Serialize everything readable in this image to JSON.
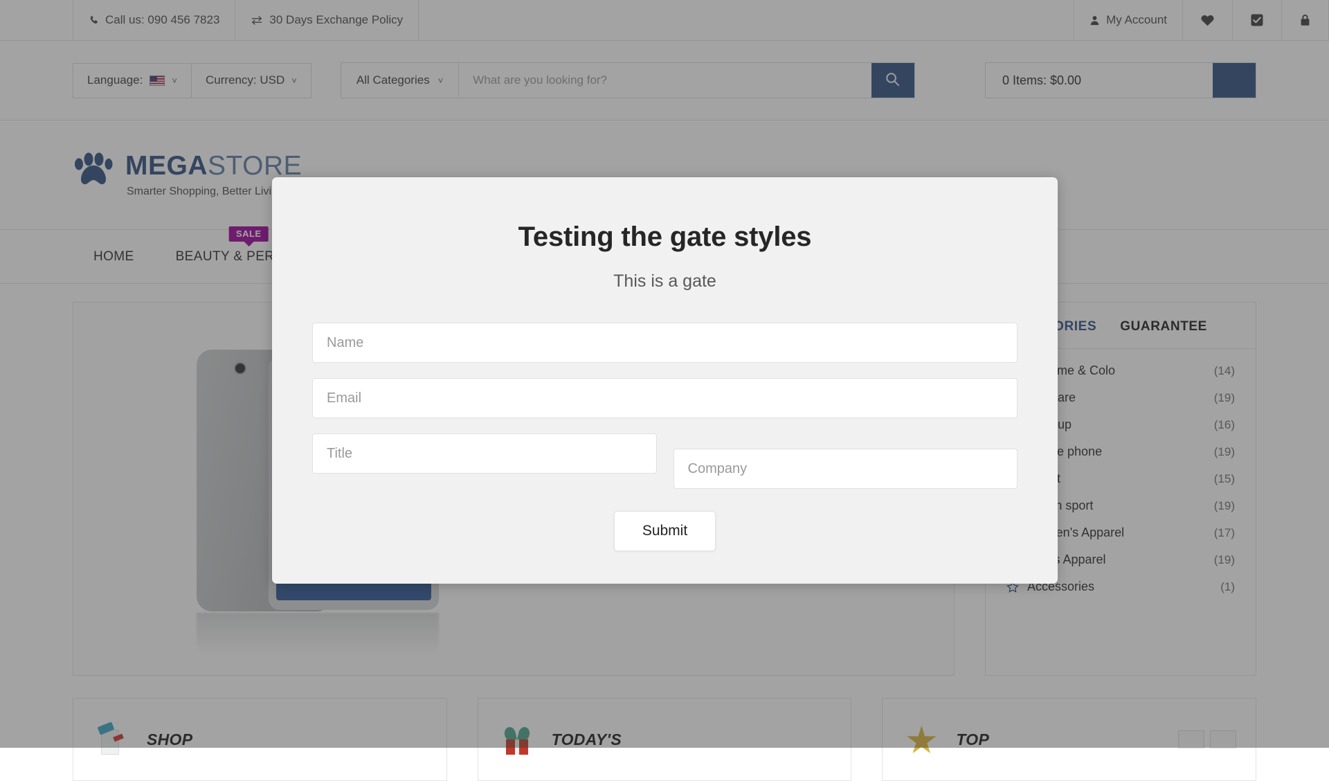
{
  "topbar": {
    "phone": "Call us: 090 456 7823",
    "exchange": "30 Days Exchange Policy",
    "account": "My Account",
    "icons": [
      "heart-icon",
      "checkbox-icon",
      "lock-icon"
    ]
  },
  "searchrow": {
    "language_label": "Language:",
    "currency_label": "Currency: USD",
    "category_select": "All Categories",
    "search_placeholder": "What are you looking for?",
    "cart_summary": "0 Items: $0.00",
    "accent_color": "#2e4f80"
  },
  "logo": {
    "word_bold": "MEGA",
    "word_light": "STORE",
    "tagline": "Smarter Shopping, Better Living",
    "mark": "paw-print-icon"
  },
  "nav": {
    "items": [
      {
        "label": "HOME",
        "badge": null
      },
      {
        "label": "BEAUTY & PERFUMES",
        "badge": "SALE"
      }
    ],
    "badge_color": "#9c009c"
  },
  "sidebar": {
    "tabs": [
      {
        "label": "CATEGORIES",
        "active": true
      },
      {
        "label": "GUARANTEE",
        "active": false
      }
    ],
    "categories": [
      {
        "label": "Perfume & Colo",
        "count": "(14)"
      },
      {
        "label": "Skincare",
        "count": "(19)"
      },
      {
        "label": "Makeup",
        "count": "(16)"
      },
      {
        "label": "Mobile phone",
        "count": "(19)"
      },
      {
        "label": "Tablet",
        "count": "(15)"
      },
      {
        "label": "Watch sport",
        "count": "(19)"
      },
      {
        "label": "Women's Apparel",
        "count": "(17)"
      },
      {
        "label": "Men's Apparel",
        "count": "(19)"
      },
      {
        "label": "Accessories",
        "count": "(1)"
      }
    ]
  },
  "promos": [
    {
      "title": "SHOP",
      "icon": "milk-carton-icon"
    },
    {
      "title": "TODAY'S",
      "icon": "gift-icon"
    },
    {
      "title": "TOP",
      "icon": "star-icon"
    }
  ],
  "modal": {
    "title": "Testing the gate styles",
    "subtitle": "This is a gate",
    "fields": {
      "name_placeholder": "Name",
      "email_placeholder": "Email",
      "title_placeholder": "Title",
      "company_placeholder": "Company"
    },
    "submit_label": "Submit",
    "background_color": "#f1f1f1"
  }
}
